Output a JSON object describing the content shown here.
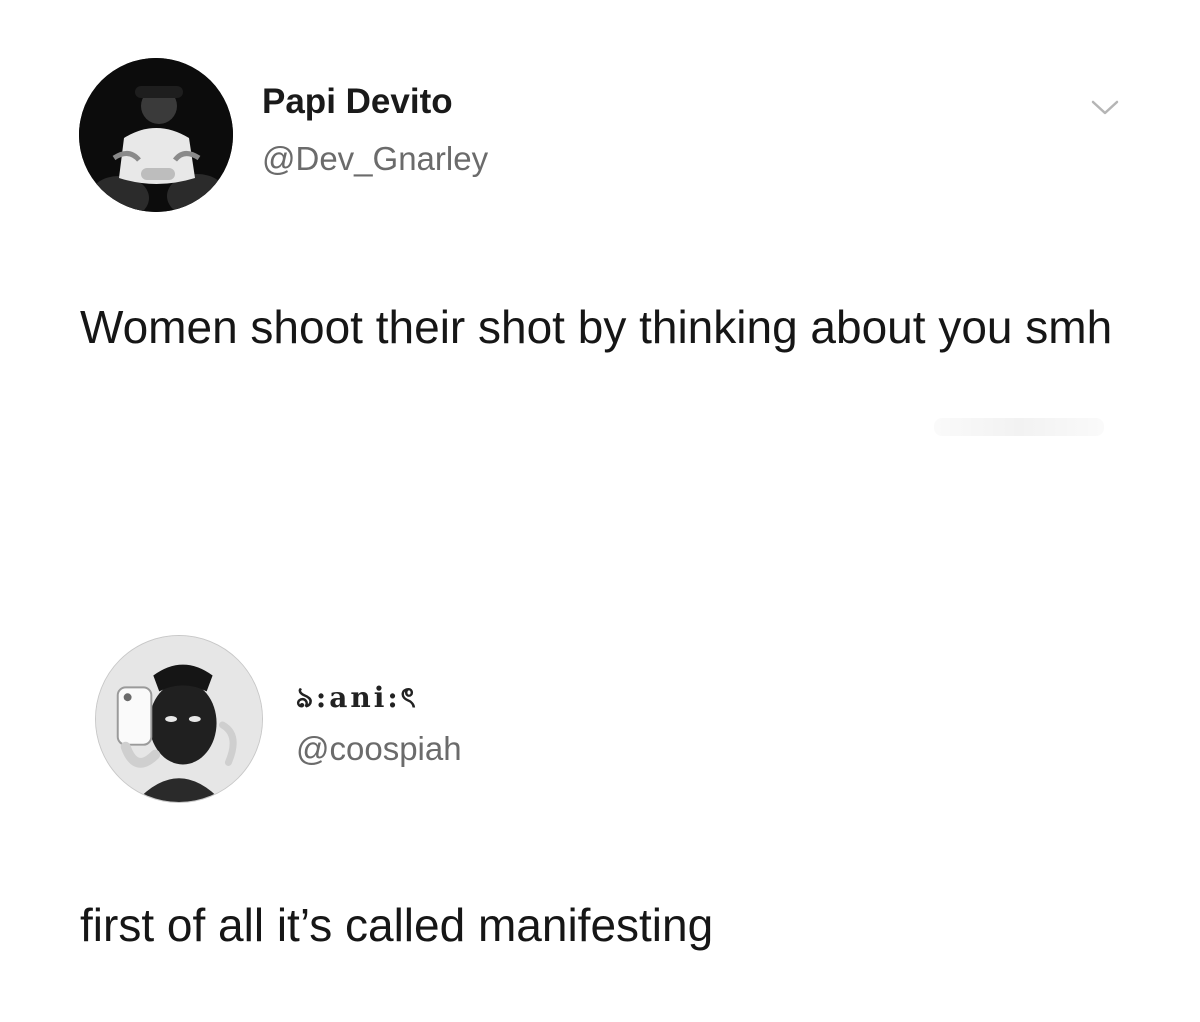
{
  "tweets": [
    {
      "display_name": "Papi Devito",
      "handle": "@Dev_Gnarley",
      "text": "Women shoot their shot by thinking about you smh",
      "avatar_icon": "user-avatar-photo",
      "menu_icon": "chevron-down-icon"
    },
    {
      "display_name": "ঌ:ani:ৎ",
      "handle": "@coospiah",
      "text": "first of all it’s called manifesting",
      "avatar_icon": "user-avatar-photo"
    }
  ],
  "colors": {
    "background": "#ffffff",
    "text": "#161616",
    "handle": "#6b6b6b",
    "chevron": "#b5b5b5"
  }
}
